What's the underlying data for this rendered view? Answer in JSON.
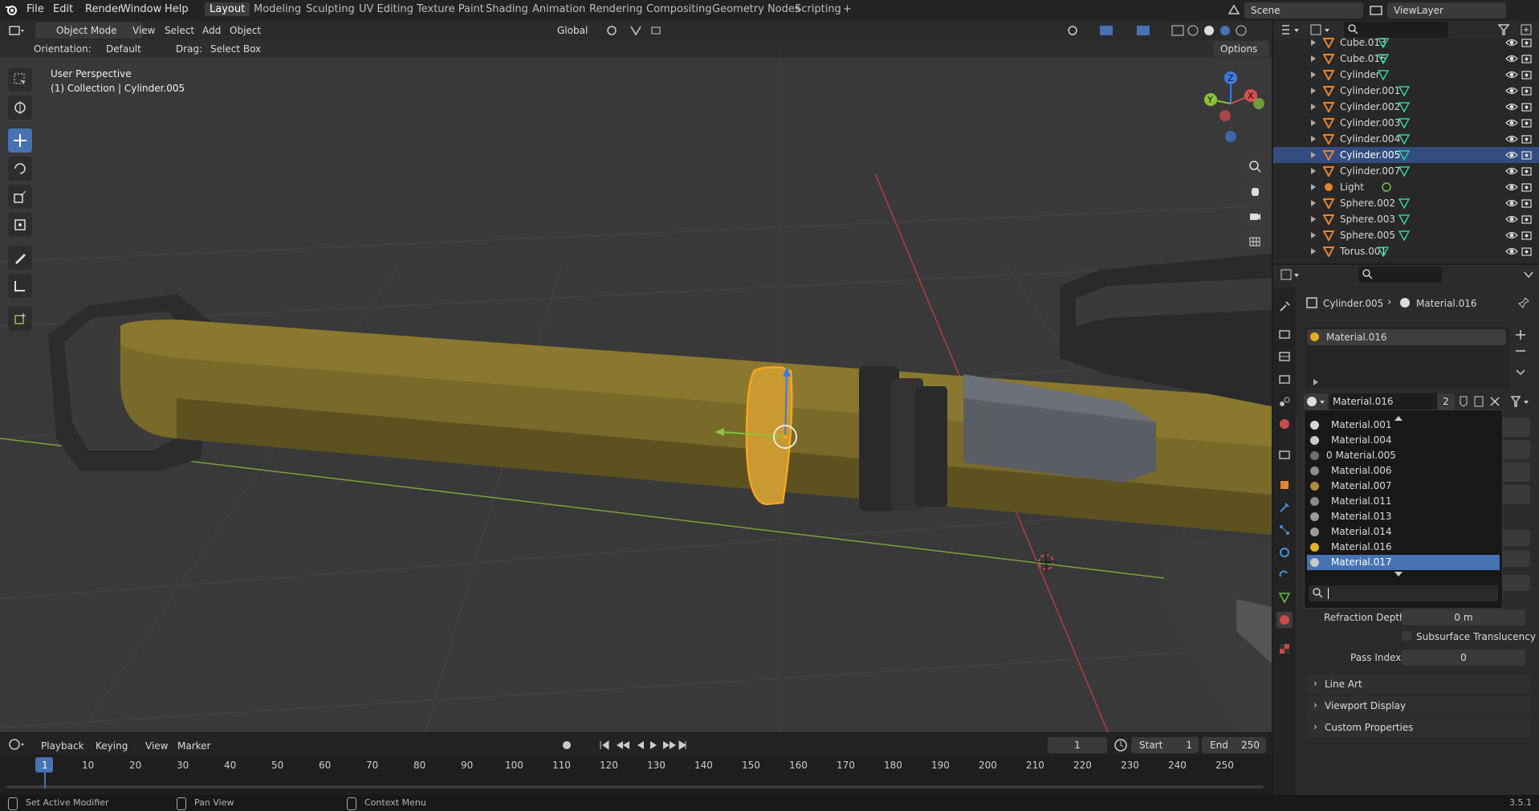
{
  "menubar": {
    "menus": [
      "File",
      "Edit",
      "Render",
      "Window",
      "Help"
    ],
    "workspaces": [
      "Layout",
      "Modeling",
      "Sculpting",
      "UV Editing",
      "Texture Paint",
      "Shading",
      "Animation",
      "Rendering",
      "Compositing",
      "Geometry Nodes",
      "Scripting"
    ],
    "add_workspace": "+",
    "scene_name": "Scene",
    "view_layer": "ViewLayer"
  },
  "viewport": {
    "mode": "Object Mode",
    "menus": [
      "View",
      "Select",
      "Add",
      "Object"
    ],
    "transform_orientation": "Global",
    "orientation_label": "Orientation:",
    "orientation_value": "Default",
    "drag_label": "Drag:",
    "drag_value": "Select Box",
    "options": "Options",
    "perspective": "User Perspective",
    "collection_info": "(1) Collection | Cylinder.005",
    "gizmo_axes": {
      "x": "X",
      "y": "Y",
      "z": "Z"
    },
    "colors": {
      "selected": "#f5a623",
      "x_axis": "#d94d4d",
      "y_axis": "#8ac33a",
      "z_axis": "#3d7be0",
      "object_tint": "#8c7a2e"
    }
  },
  "timeline": {
    "menus": [
      "Playback",
      "Keying",
      "View",
      "Marker"
    ],
    "current_frame": "1",
    "start_label": "Start",
    "start": "1",
    "end_label": "End",
    "end": "250",
    "ruler": [
      "1",
      "10",
      "20",
      "30",
      "40",
      "50",
      "60",
      "70",
      "80",
      "90",
      "100",
      "110",
      "120",
      "130",
      "140",
      "150",
      "160",
      "170",
      "180",
      "190",
      "200",
      "210",
      "220",
      "230",
      "240",
      "250"
    ]
  },
  "statusbar": {
    "left": "Set Active Modifier",
    "middle": "Pan View",
    "right": "Context Menu",
    "version": "3.5.1"
  },
  "outliner": {
    "items": [
      {
        "name": "Cube.013",
        "selected": false,
        "icon": "mesh-icon"
      },
      {
        "name": "Cube.016",
        "selected": false,
        "icon": "mesh-icon"
      },
      {
        "name": "Cylinder",
        "selected": false,
        "icon": "mesh-icon"
      },
      {
        "name": "Cylinder.001",
        "selected": false,
        "icon": "mesh-icon"
      },
      {
        "name": "Cylinder.002",
        "selected": false,
        "icon": "mesh-icon"
      },
      {
        "name": "Cylinder.003",
        "selected": false,
        "icon": "mesh-icon"
      },
      {
        "name": "Cylinder.004",
        "selected": false,
        "icon": "mesh-icon"
      },
      {
        "name": "Cylinder.005",
        "selected": true,
        "icon": "mesh-icon"
      },
      {
        "name": "Cylinder.007",
        "selected": false,
        "icon": "mesh-icon"
      },
      {
        "name": "Light",
        "selected": false,
        "icon": "light-icon"
      },
      {
        "name": "Sphere.002",
        "selected": false,
        "icon": "mesh-icon"
      },
      {
        "name": "Sphere.003",
        "selected": false,
        "icon": "mesh-icon"
      },
      {
        "name": "Sphere.005",
        "selected": false,
        "icon": "mesh-icon"
      },
      {
        "name": "Torus.001",
        "selected": false,
        "icon": "mesh-icon"
      }
    ]
  },
  "properties": {
    "breadcrumb_object": "Cylinder.005",
    "breadcrumb_material": "Material.016",
    "slot_name": "Material.016",
    "material_field": "Material.016",
    "user_count": "2",
    "dropdown": {
      "items": [
        {
          "name": "Material.001",
          "color": "#d6d6d6",
          "highlight": false
        },
        {
          "name": "Material.004",
          "color": "#c8c8c8",
          "highlight": false
        },
        {
          "name": "0 Material.005",
          "color": "#707070",
          "highlight": false
        },
        {
          "name": "Material.006",
          "color": "#8c8c8c",
          "highlight": false
        },
        {
          "name": "Material.007",
          "color": "#b08d3a",
          "highlight": false
        },
        {
          "name": "Material.011",
          "color": "#8a8a8a",
          "highlight": false
        },
        {
          "name": "Material.013",
          "color": "#9a9a9a",
          "highlight": false
        },
        {
          "name": "Material.014",
          "color": "#9a9a9a",
          "highlight": false
        },
        {
          "name": "Material.016",
          "color": "#e0b020",
          "highlight": false
        },
        {
          "name": "Material.017",
          "color": "#c9c9c9",
          "highlight": true
        }
      ],
      "search_placeholder": ""
    },
    "refraction_depth_label": "Refraction Depth",
    "refraction_depth_value": "0 m",
    "subsurface_label": "Subsurface Translucency",
    "pass_index_label": "Pass Index",
    "pass_index_value": "0",
    "panels": [
      "Line Art",
      "Viewport Display",
      "Custom Properties"
    ]
  }
}
